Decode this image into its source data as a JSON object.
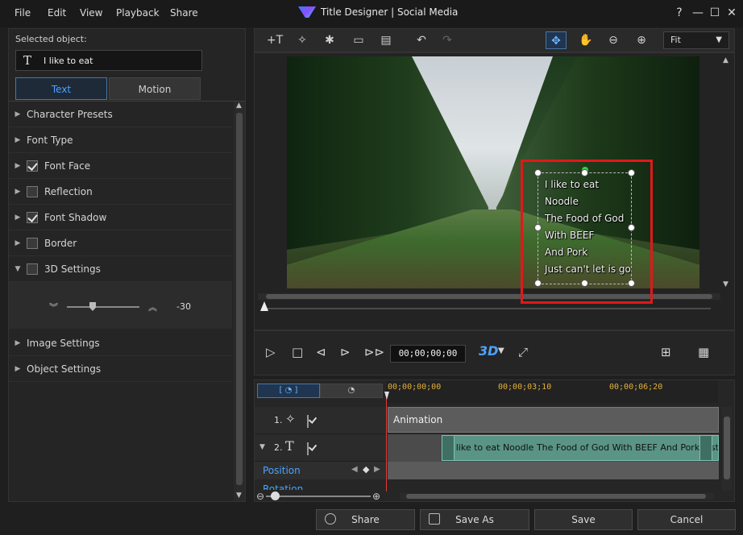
{
  "window": {
    "title": "Title Designer | Social Media",
    "menu": [
      "File",
      "Edit",
      "View",
      "Playback",
      "Share"
    ],
    "controls": {
      "help": "?",
      "minimize": "—",
      "maximize": "☐",
      "close": "✕"
    }
  },
  "left_panel": {
    "selected_label": "Selected object:",
    "selected_value": "I like to eat",
    "tabs": [
      "Text",
      "Motion"
    ],
    "active_tab": "Text",
    "items": [
      {
        "label": "Character Presets",
        "checkbox": null,
        "expanded": false
      },
      {
        "label": "Font Type",
        "checkbox": null,
        "expanded": false
      },
      {
        "label": "Font Face",
        "checkbox": true,
        "expanded": false
      },
      {
        "label": "Reflection",
        "checkbox": false,
        "expanded": false
      },
      {
        "label": "Font Shadow",
        "checkbox": true,
        "expanded": false
      },
      {
        "label": "Border",
        "checkbox": false,
        "expanded": false
      },
      {
        "label": "3D Settings",
        "checkbox": false,
        "expanded": true
      },
      {
        "label": "Image Settings",
        "checkbox": null,
        "expanded": false
      },
      {
        "label": "Object Settings",
        "checkbox": null,
        "expanded": false
      }
    ],
    "settings_3d_value": "-30"
  },
  "toolbar": {
    "icons": [
      "insert-title-icon",
      "insert-particle-icon",
      "insert-effect-icon",
      "insert-image-icon",
      "insert-background-icon",
      "undo-icon",
      "redo-icon",
      "select-mode-icon",
      "hand-icon",
      "zoom-out-icon",
      "zoom-in-icon"
    ],
    "fit_value": "Fit"
  },
  "preview": {
    "text_lines": [
      "I like to eat",
      "Noodle",
      "The Food of God",
      "With BEEF",
      "And Pork",
      "Just can't let is go"
    ]
  },
  "controls": {
    "timecode": "00;00;00;00",
    "three_d_label": "3D"
  },
  "timeline": {
    "ruler_ticks": [
      "00;00;00;00",
      "00;00;03;10",
      "00;00;06;20"
    ],
    "tracks": [
      {
        "number": "1.",
        "clip_label": "Animation"
      },
      {
        "number": "2.",
        "clip_label": "I like to eat Noodle The Food of God With BEEF And Pork Just can't let is go"
      }
    ],
    "sub_rows": [
      "Position",
      "Rotation"
    ]
  },
  "bottom": {
    "share": "Share",
    "save_as": "Save As",
    "save": "Save",
    "cancel": "Cancel"
  },
  "colors": {
    "accent": "#4aa3ff",
    "highlight": "#e01919",
    "clip": "#5a9485"
  }
}
